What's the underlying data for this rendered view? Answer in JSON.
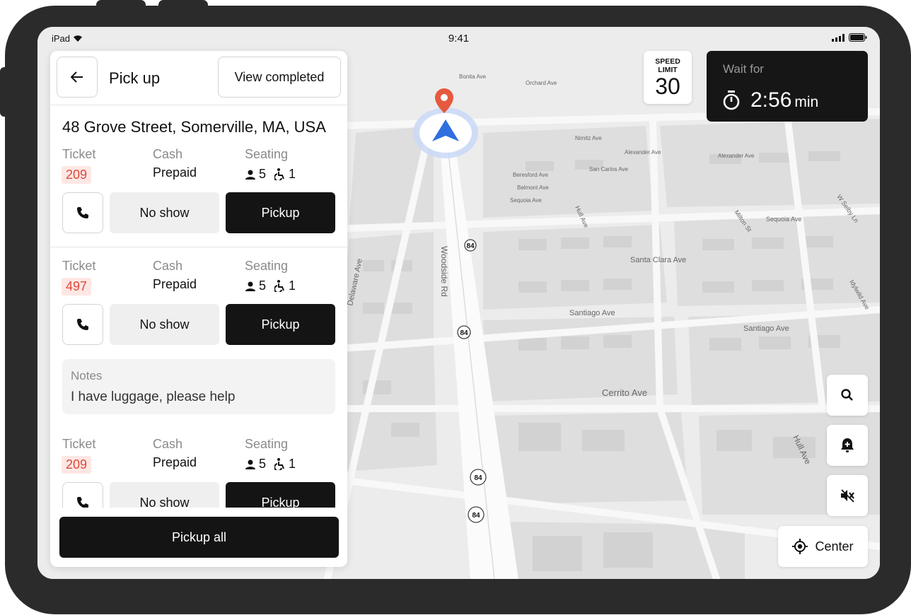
{
  "status_bar": {
    "device": "iPad",
    "time": "9:41"
  },
  "panel": {
    "title": "Pick up",
    "view_completed_label": "View completed",
    "address": "48 Grove Street, Somerville, MA, USA",
    "labels": {
      "ticket": "Ticket",
      "payment": "Cash",
      "seating": "Seating"
    },
    "stops": [
      {
        "ticket": "209",
        "payment_status": "Prepaid",
        "seats": "5",
        "wheelchair": "1",
        "no_show_label": "No show",
        "pickup_label": "Pickup"
      },
      {
        "ticket": "497",
        "payment_status": "Prepaid",
        "seats": "5",
        "wheelchair": "1",
        "no_show_label": "No show",
        "pickup_label": "Pickup"
      },
      {
        "ticket": "209",
        "payment_status": "Prepaid",
        "seats": "5",
        "wheelchair": "1",
        "no_show_label": "No show",
        "pickup_label": "Pickup"
      }
    ],
    "notes": {
      "label": "Notes",
      "text": "I have luggage, please help"
    },
    "pickup_all_label": "Pickup all"
  },
  "speed_limit": {
    "label_line1": "SPEED",
    "label_line2": "LIMIT",
    "value": "30"
  },
  "wait": {
    "label": "Wait for",
    "time": "2:56",
    "unit": "min"
  },
  "map": {
    "streets": [
      "Santa Clara Ave",
      "Santiago Ave",
      "Santiago Ave",
      "Cerrito Ave",
      "Woodside Rd",
      "Delaware Ave",
      "Hull Ave",
      "Hull Ave",
      "Milton St",
      "Sequoia Ave",
      "Sequoia Ave",
      "Beresford Ave",
      "Belmont Ave",
      "San Carlos Ave",
      "Alexander Ave",
      "Alexander Ave",
      "Nimitz Ave",
      "Idylwild Ave",
      "W Selby Ln",
      "Bonita Ave",
      "Orchard Ave"
    ],
    "route_shield": "84",
    "center_label": "Center",
    "colors": {
      "accent": "#2f6fe0",
      "pin": "#e55a3f"
    }
  },
  "icons": {
    "back": "arrow-left-icon",
    "phone": "phone-icon",
    "person": "person-icon",
    "wheelchair": "wheelchair-icon",
    "timer": "timer-icon",
    "search": "search-icon",
    "alert": "alert-bell-icon",
    "mute": "volume-mute-icon",
    "locate": "locate-icon"
  }
}
